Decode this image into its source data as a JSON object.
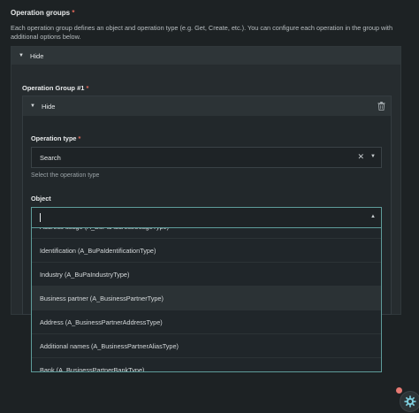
{
  "section": {
    "title": "Operation groups",
    "required_mark": "*",
    "description": "Each operation group defines an object and operation type (e.g. Get, Create, etc.). You can configure each operation in the group with additional options below."
  },
  "outer": {
    "toggle_label": "Hide"
  },
  "group": {
    "label": "Operation Group #1",
    "required_mark": "*",
    "toggle_label": "Hide"
  },
  "operation_type": {
    "label": "Operation type",
    "required_mark": "*",
    "value": "Search",
    "helper": "Select the operation type"
  },
  "object": {
    "label": "Object",
    "value": "",
    "options": [
      "Address usage (A_BuPaAddressUsageType)",
      "Identification (A_BuPaIdentificationType)",
      "Industry (A_BuPaIndustryType)",
      "Business partner (A_BusinessPartnerType)",
      "Address (A_BusinessPartnerAddressType)",
      "Additional names (A_BusinessPartnerAliasType)",
      "Bank (A_BusinessPartnerBankType)"
    ],
    "hovered_index": 3
  },
  "icons": {
    "collapse": "caret-down-icon",
    "delete": "trash-icon",
    "clear": "close-icon",
    "dropdown": "chevron-icon",
    "help": "help-bot-icon"
  }
}
